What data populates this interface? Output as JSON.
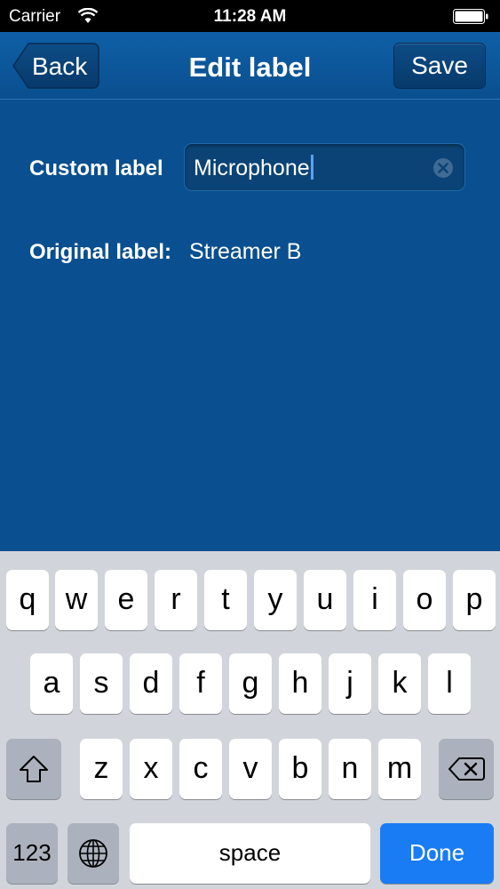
{
  "status_bar": {
    "carrier": "Carrier",
    "time": "11:28 AM"
  },
  "nav": {
    "title": "Edit label",
    "back_label": "Back",
    "save_label": "Save"
  },
  "form": {
    "custom_label_caption": "Custom label",
    "custom_label_value": "Microphone",
    "original_label_caption": "Original label:",
    "original_label_value": "Streamer B"
  },
  "keyboard": {
    "row1": [
      "q",
      "w",
      "e",
      "r",
      "t",
      "y",
      "u",
      "i",
      "o",
      "p"
    ],
    "row2": [
      "a",
      "s",
      "d",
      "f",
      "g",
      "h",
      "j",
      "k",
      "l"
    ],
    "row3": [
      "z",
      "x",
      "c",
      "v",
      "b",
      "n",
      "m"
    ],
    "numbers_label": "123",
    "space_label": "space",
    "done_label": "Done"
  },
  "colors": {
    "background": "#0a4f8f",
    "done_key": "#1a7cf5",
    "keyboard_bg": "#d1d5db"
  },
  "icons": [
    "wifi-icon",
    "battery-icon",
    "clear-icon",
    "shift-icon",
    "delete-icon",
    "globe-icon"
  ]
}
